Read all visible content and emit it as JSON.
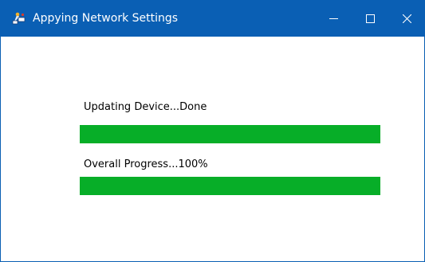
{
  "window": {
    "title": "Appying Network Settings",
    "icon": "network-settings-icon",
    "controls": {
      "minimize_icon": "minimize-icon",
      "maximize_icon": "maximize-icon",
      "close_icon": "close-icon"
    },
    "colors": {
      "titlebar": "#0a5fb4",
      "progress": "#07ae28"
    }
  },
  "tasks": [
    {
      "label": "Updating Device...Done",
      "progress": 1.0
    },
    {
      "label": "Overall Progress...100%",
      "progress": 1.0
    }
  ]
}
